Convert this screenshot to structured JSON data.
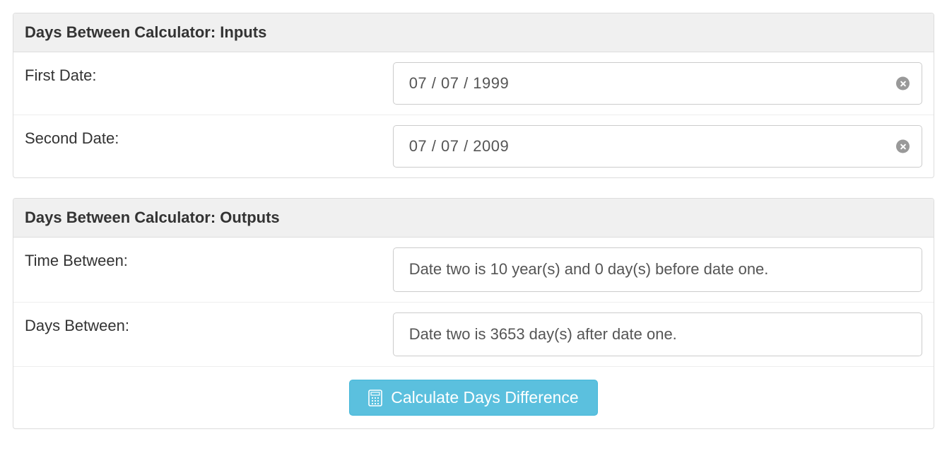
{
  "inputs": {
    "heading": "Days Between Calculator: Inputs",
    "first_date": {
      "label": "First Date:",
      "value": "07 / 07 / 1999"
    },
    "second_date": {
      "label": "Second Date:",
      "value": "07 / 07 / 2009"
    }
  },
  "outputs": {
    "heading": "Days Between Calculator: Outputs",
    "time_between": {
      "label": "Time Between:",
      "value": "Date two is 10 year(s) and 0 day(s) before date one."
    },
    "days_between": {
      "label": "Days Between:",
      "value": "Date two is 3653 day(s) after date one."
    },
    "button_label": "Calculate Days Difference"
  }
}
